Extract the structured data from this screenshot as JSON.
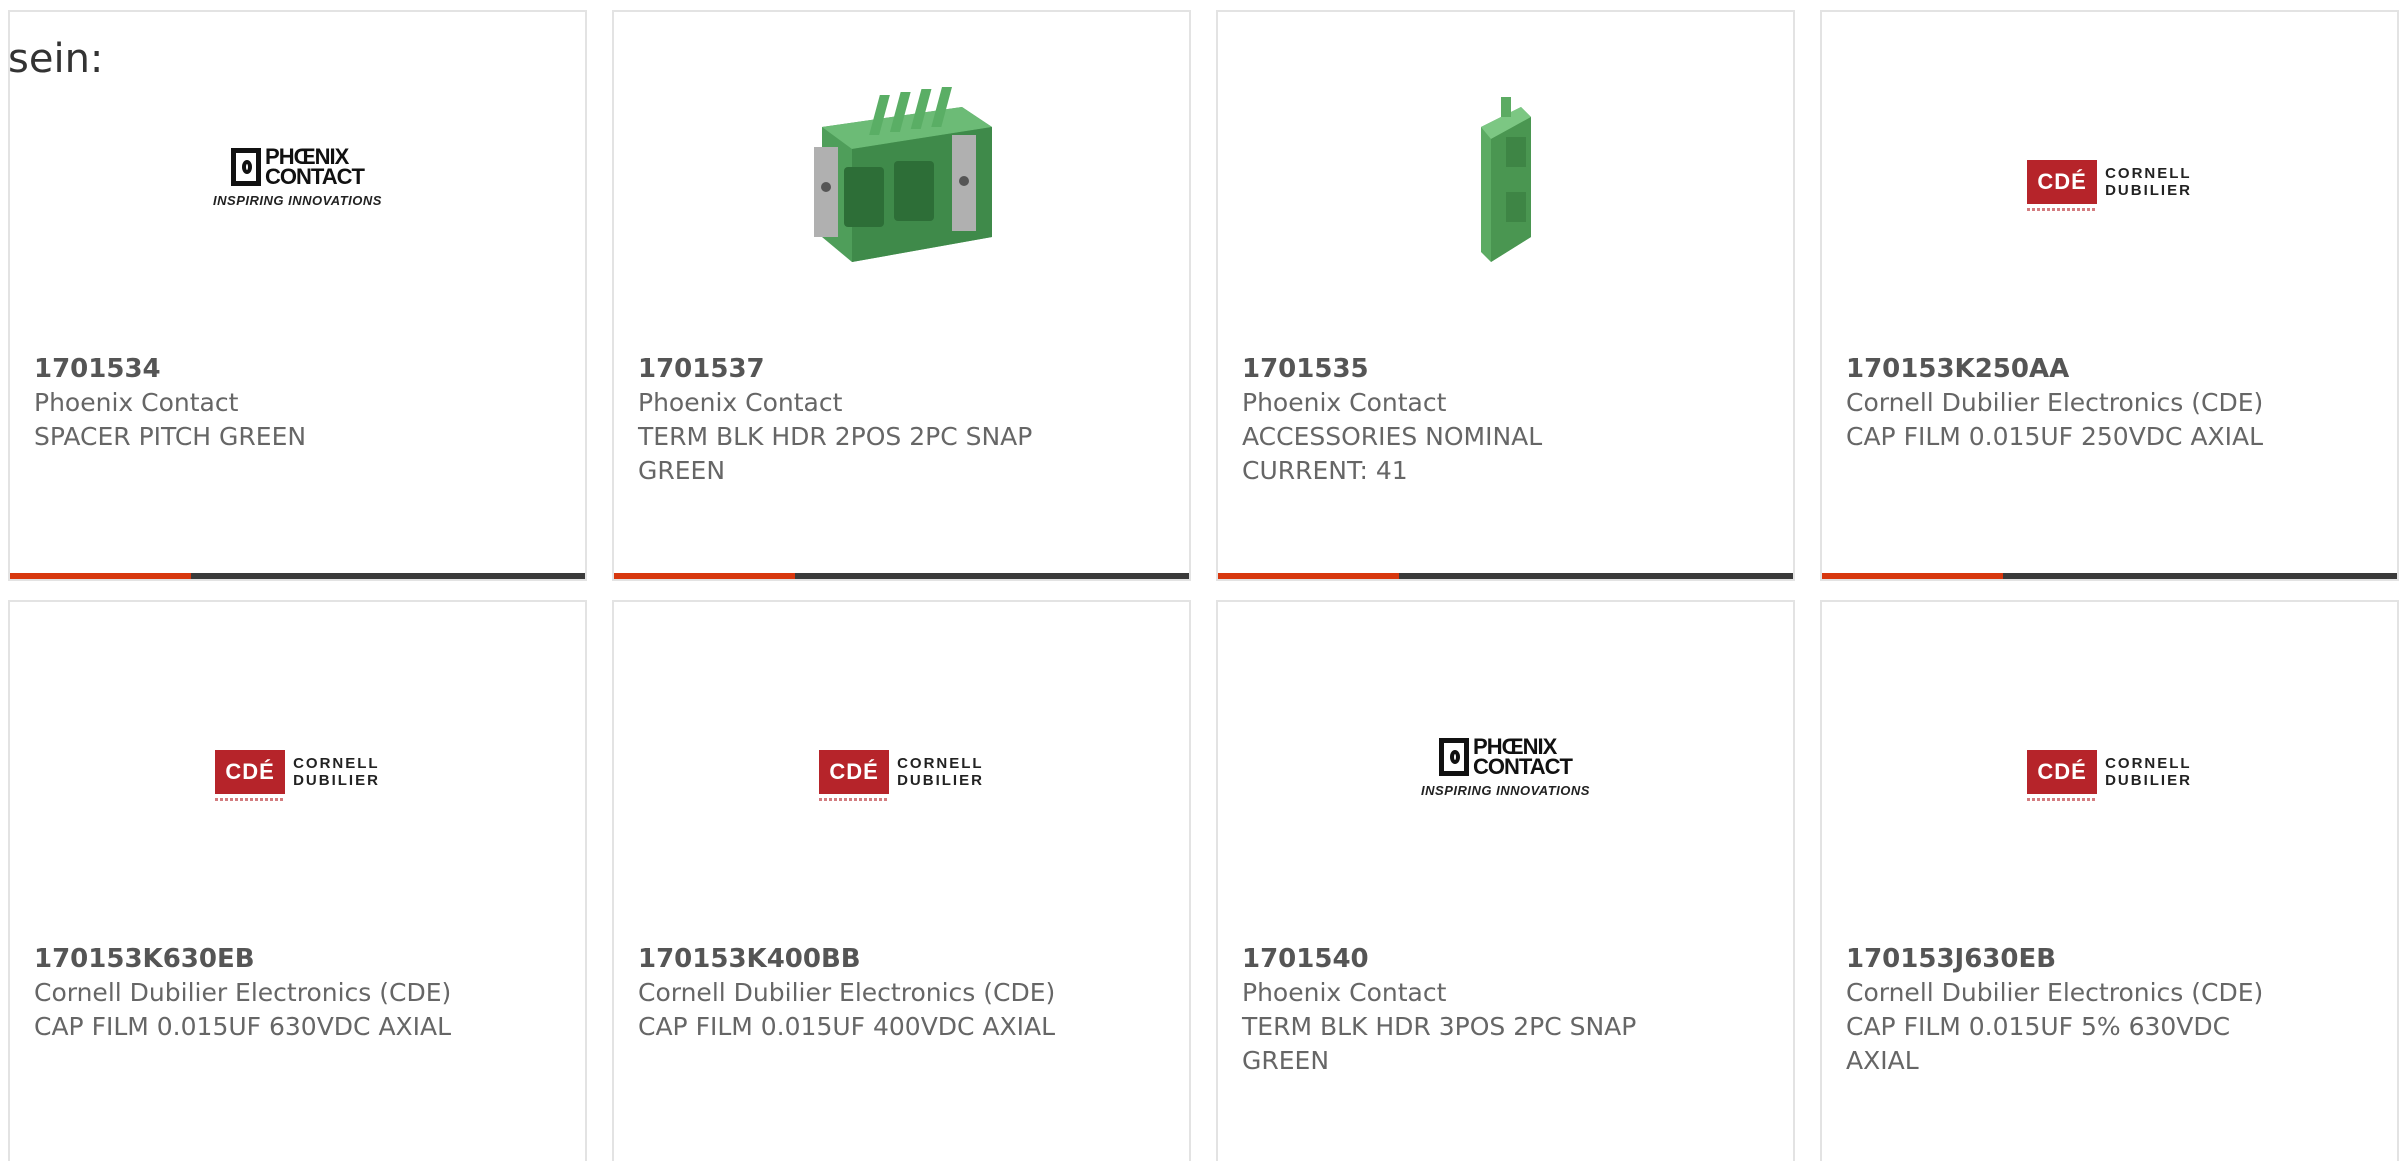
{
  "intro_text": "sein:",
  "colors": {
    "accent": "#d7370e",
    "bar": "#3a3a3a",
    "border": "#e3e3e3",
    "text": "#666666"
  },
  "logos": {
    "phoenix": {
      "line1": "PHŒNIX",
      "line2": "CONTACT",
      "tagline": "INSPIRING INNOVATIONS"
    },
    "cde": {
      "mark": "CDÉ",
      "line1": "CORNELL",
      "line2": "DUBILIER"
    }
  },
  "products": [
    {
      "part_number": "1701534",
      "manufacturer": "Phoenix Contact",
      "description": "SPACER PITCH GREEN",
      "image": "phoenix-logo"
    },
    {
      "part_number": "1701537",
      "manufacturer": "Phoenix Contact",
      "description": "TERM BLK HDR 2POS 2PC SNAP GREEN",
      "image": "connector-photo"
    },
    {
      "part_number": "1701535",
      "manufacturer": "Phoenix Contact",
      "description": "ACCESSORIES NOMINAL CURRENT: 41",
      "image": "spacer-photo"
    },
    {
      "part_number": "170153K250AA",
      "manufacturer": "Cornell Dubilier Electronics (CDE)",
      "description": "CAP FILM 0.015UF 250VDC AXIAL",
      "image": "cde-logo"
    },
    {
      "part_number": "170153K630EB",
      "manufacturer": "Cornell Dubilier Electronics (CDE)",
      "description": "CAP FILM 0.015UF 630VDC AXIAL",
      "image": "cde-logo"
    },
    {
      "part_number": "170153K400BB",
      "manufacturer": "Cornell Dubilier Electronics (CDE)",
      "description": "CAP FILM 0.015UF 400VDC AXIAL",
      "image": "cde-logo"
    },
    {
      "part_number": "1701540",
      "manufacturer": "Phoenix Contact",
      "description": "TERM BLK HDR 3POS 2PC SNAP GREEN",
      "image": "phoenix-logo"
    },
    {
      "part_number": "170153J630EB",
      "manufacturer": "Cornell Dubilier Electronics (CDE)",
      "description": "CAP FILM 0.015UF 5% 630VDC AXIAL",
      "image": "cde-logo"
    }
  ]
}
